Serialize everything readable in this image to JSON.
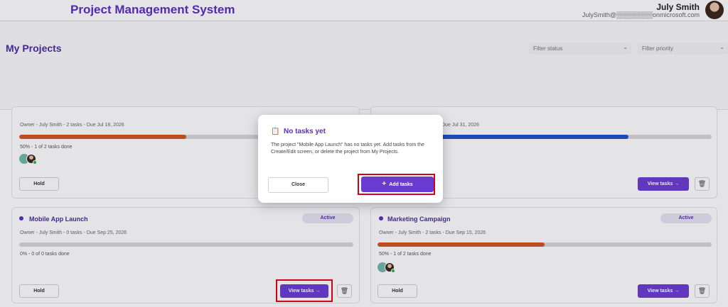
{
  "header": {
    "app_title": "Project Management System",
    "user_name": "July Smith",
    "user_email": "JulySmith@▒▒▒▒▒▒▒▒onmicrosoft.com"
  },
  "page": {
    "title": "My Projects",
    "filter_status_placeholder": "Filter status",
    "filter_priority_placeholder": "Filter priority"
  },
  "cards": {
    "top_left": {
      "meta": "Owner - July Smith - 2 tasks - Due Jul 18, 2026",
      "progress_text": "50% - 1 of 2 tasks done",
      "progress": 0.5,
      "progress_color": "#d2541e",
      "hold_label": "Hold"
    },
    "top_right": {
      "meta": "Due Jul 31, 2026",
      "progress": 0.75,
      "progress_color": "#1e52c8",
      "view_label": "View tasks →"
    },
    "mobile": {
      "title": "Mobile App Launch",
      "status": "Active",
      "meta": "Owner - July Smith - 0 tasks - Due Sep 25, 2026",
      "progress_text": "0% - 0 of 0 tasks done",
      "progress": 0,
      "hold_label": "Hold",
      "view_label": "View tasks →"
    },
    "marketing": {
      "title": "Marketing Campaign",
      "status": "Active",
      "meta": "Owner - July Smith - 2 tasks - Due Sep 15, 2026",
      "progress_text": "50% - 1 of 2 tasks done",
      "progress": 0.5,
      "progress_color": "#d2541e",
      "hold_label": "Hold",
      "view_label": "View tasks →"
    }
  },
  "modal": {
    "title": "No tasks yet",
    "body": "The project \"Mobile App Launch\" has no tasks yet. Add tasks from the Create/Edit screen, or delete the project from My Projects.",
    "close_label": "Close",
    "add_label": "Add tasks"
  },
  "icons": {
    "clipboard": "📋",
    "trash": "🗑",
    "plus": "+",
    "chevron": "⌄"
  },
  "colors": {
    "brand": "#5b2bbf",
    "button": "#6a3bd0",
    "highlight": "#d0021b"
  }
}
